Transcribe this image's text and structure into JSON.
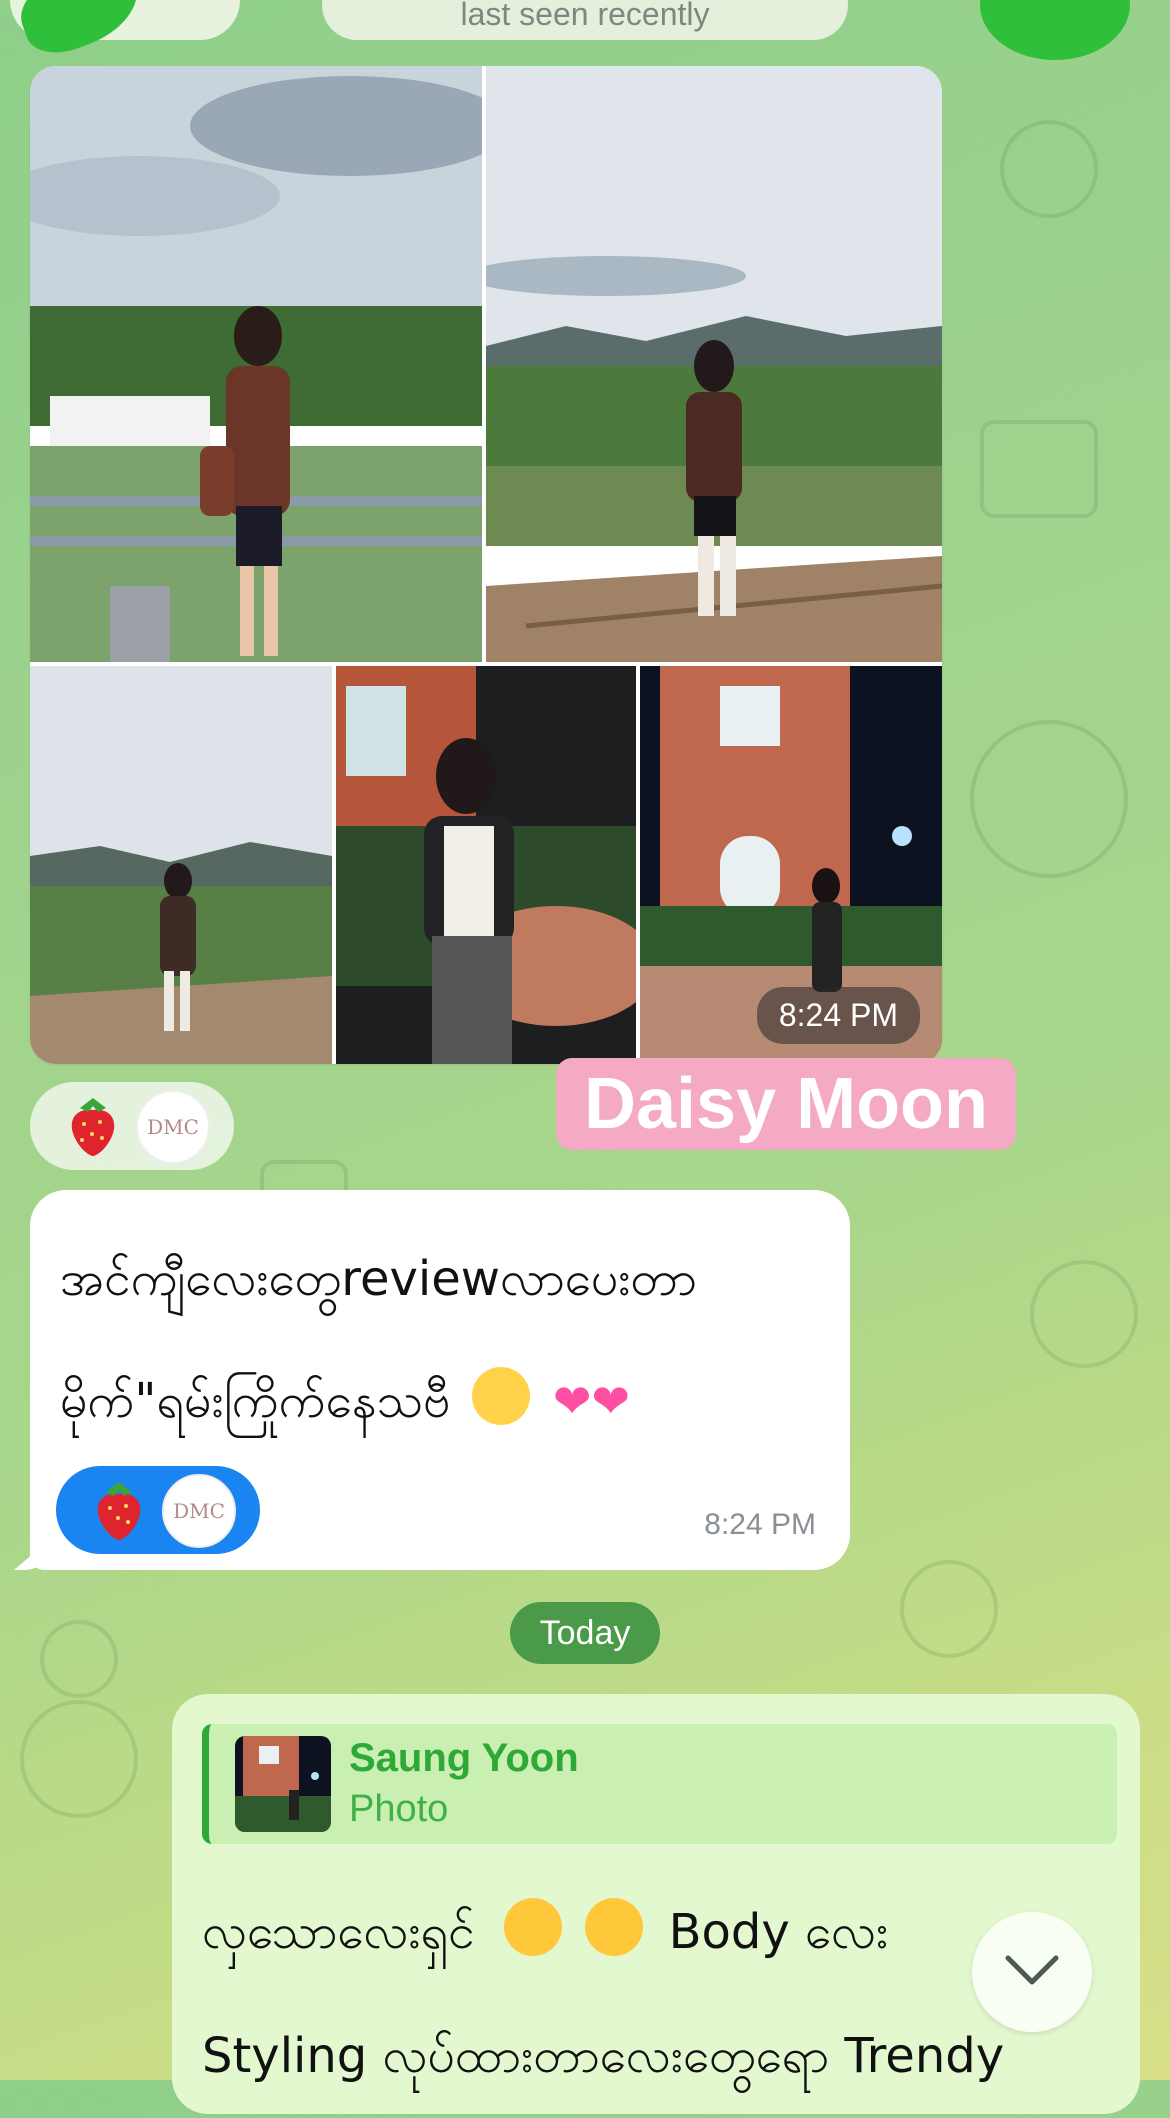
{
  "header": {
    "status_text": "last seen recently"
  },
  "album": {
    "time": "8:24 PM",
    "photo_count": 5
  },
  "watermark": {
    "text": "Daisy Moon"
  },
  "incoming_message": {
    "line1": "အင်ကျီလေးတွေreviewလာပေးတာ",
    "line2": "မိုက်\"ရမ်းကြိုက်နေသဗီ",
    "time": "8:24 PM",
    "reaction_logo": "DMC"
  },
  "top_reaction": {
    "logo": "DMC"
  },
  "date_separator": {
    "label": "Today"
  },
  "outgoing_message": {
    "reply_name": "Saung Yoon",
    "reply_type": "Photo",
    "line1_a": "လှသောလေးရှင်",
    "line1_b": "Body လေး",
    "line2": "Styling လုပ်ထားတာလေးတွေရော Trendy"
  },
  "colors": {
    "accent_green": "#2ea836",
    "reaction_blue": "#1a84f0",
    "watermark_pink": "#f4a9c4",
    "date_chip": "#4a9a4a"
  },
  "icons": {
    "scroll": "chevron-down-icon",
    "reaction": "strawberry-icon"
  }
}
